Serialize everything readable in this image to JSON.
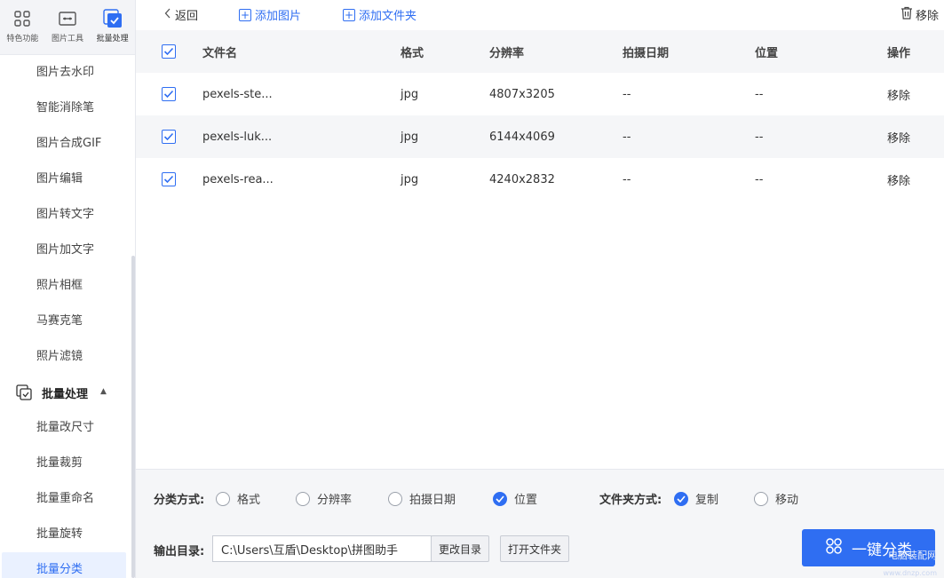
{
  "sidebar": {
    "top_tabs": [
      {
        "label": "特色功能",
        "icon": "grid-icon"
      },
      {
        "label": "图片工具",
        "icon": "image-tool-icon"
      },
      {
        "label": "批量处理",
        "icon": "batch-icon"
      }
    ],
    "items": [
      {
        "label": "图片去水印"
      },
      {
        "label": "智能消除笔"
      },
      {
        "label": "图片合成GIF"
      },
      {
        "label": "图片编辑"
      },
      {
        "label": "图片转文字"
      },
      {
        "label": "图片加文字"
      },
      {
        "label": "照片相框"
      },
      {
        "label": "马赛克笔"
      },
      {
        "label": "照片滤镜"
      }
    ],
    "group": {
      "label": "批量处理",
      "icon": "batch-icon",
      "expanded": true
    },
    "group_items": [
      {
        "label": "批量改尺寸"
      },
      {
        "label": "批量裁剪"
      },
      {
        "label": "批量重命名"
      },
      {
        "label": "批量旋转"
      },
      {
        "label": "批量分类",
        "active": true
      }
    ]
  },
  "toolbar": {
    "back_label": "返回",
    "add_image_label": "添加图片",
    "add_folder_label": "添加文件夹",
    "remove_label": "移除"
  },
  "table": {
    "headers": {
      "name": "文件名",
      "format": "格式",
      "resolution": "分辨率",
      "date": "拍摄日期",
      "location": "位置",
      "action": "操作"
    },
    "rows": [
      {
        "name": "pexels-ste...",
        "format": "jpg",
        "resolution": "4807x3205",
        "date": "--",
        "location": "--",
        "action": "移除",
        "checked": true
      },
      {
        "name": "pexels-luk...",
        "format": "jpg",
        "resolution": "6144x4069",
        "date": "--",
        "location": "--",
        "action": "移除",
        "checked": true
      },
      {
        "name": "pexels-rea...",
        "format": "jpg",
        "resolution": "4240x2832",
        "date": "--",
        "location": "--",
        "action": "移除",
        "checked": true
      }
    ]
  },
  "bottom": {
    "classify_label": "分类方式:",
    "classify_options": [
      {
        "label": "格式",
        "selected": false
      },
      {
        "label": "分辨率",
        "selected": false
      },
      {
        "label": "拍摄日期",
        "selected": false
      },
      {
        "label": "位置",
        "selected": true
      }
    ],
    "folder_mode_label": "文件夹方式:",
    "folder_mode_options": [
      {
        "label": "复制",
        "selected": true
      },
      {
        "label": "移动",
        "selected": false
      }
    ],
    "output_label": "输出目录:",
    "output_path": "C:\\Users\\互盾\\Desktop\\拼图助手",
    "change_dir_label": "更改目录",
    "open_folder_label": "打开文件夹",
    "primary_label": "一键分类",
    "watermark": "电脑装配网",
    "watermark_sub": "www.dnzp.com"
  },
  "colors": {
    "accent": "#2f6ef2",
    "row_alt": "#f5f6f8",
    "active_bg": "#eaf1ff"
  }
}
